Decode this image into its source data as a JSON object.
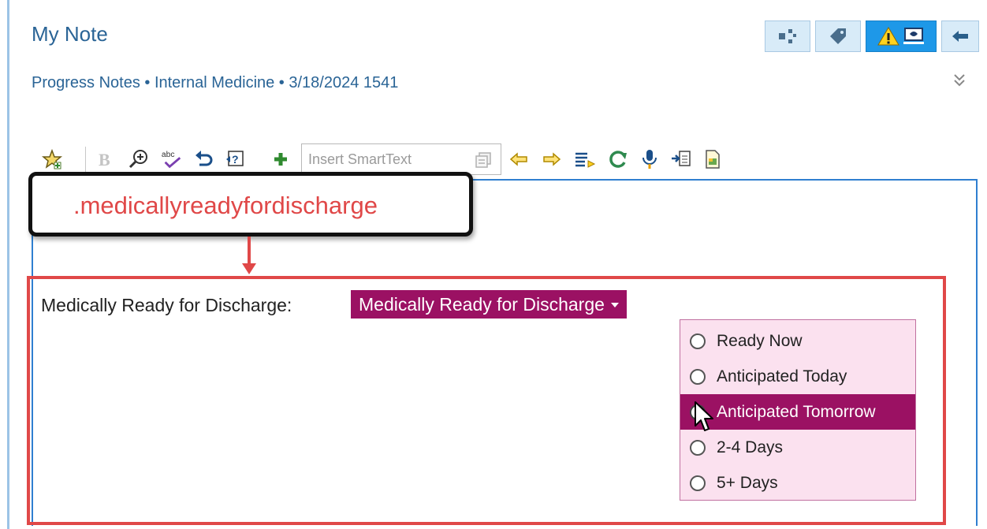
{
  "note": {
    "title": "My Note",
    "subtitle": "Progress Notes • Internal Medicine •  3/18/2024 1541"
  },
  "header_buttons": [
    {
      "icon": "share-icon"
    },
    {
      "icon": "tag-icon"
    },
    {
      "icon": "warning-icon",
      "active": true
    },
    {
      "icon": "back-arrow-icon"
    }
  ],
  "toolbar": {
    "smarttext_placeholder": "Insert SmartText",
    "icons": [
      "star-icon",
      "bold-icon",
      "zoom-icon",
      "spellcheck-icon",
      "undo-icon",
      "help-icon",
      "add-icon",
      "copy-icon",
      "prev-arrow-icon",
      "next-arrow-icon",
      "list-icon",
      "refresh-icon",
      "microphone-icon",
      "import-icon",
      "document-icon"
    ]
  },
  "callout": {
    "text": ".medicallyreadyfordischarge"
  },
  "smartlist": {
    "label": "Medically Ready for Discharge:",
    "value": "Medically Ready for Discharge",
    "options": [
      {
        "label": "Ready Now",
        "selected": false
      },
      {
        "label": "Anticipated Today",
        "selected": false
      },
      {
        "label": "Anticipated Tomorrow",
        "selected": true
      },
      {
        "label": "2-4 Days",
        "selected": false
      },
      {
        "label": "5+ Days",
        "selected": false
      }
    ]
  },
  "colors": {
    "accent_blue": "#2a6496",
    "pill_magenta": "#9b1163",
    "annotation_red": "#e04848",
    "dropdown_bg": "#fbe1ef"
  }
}
